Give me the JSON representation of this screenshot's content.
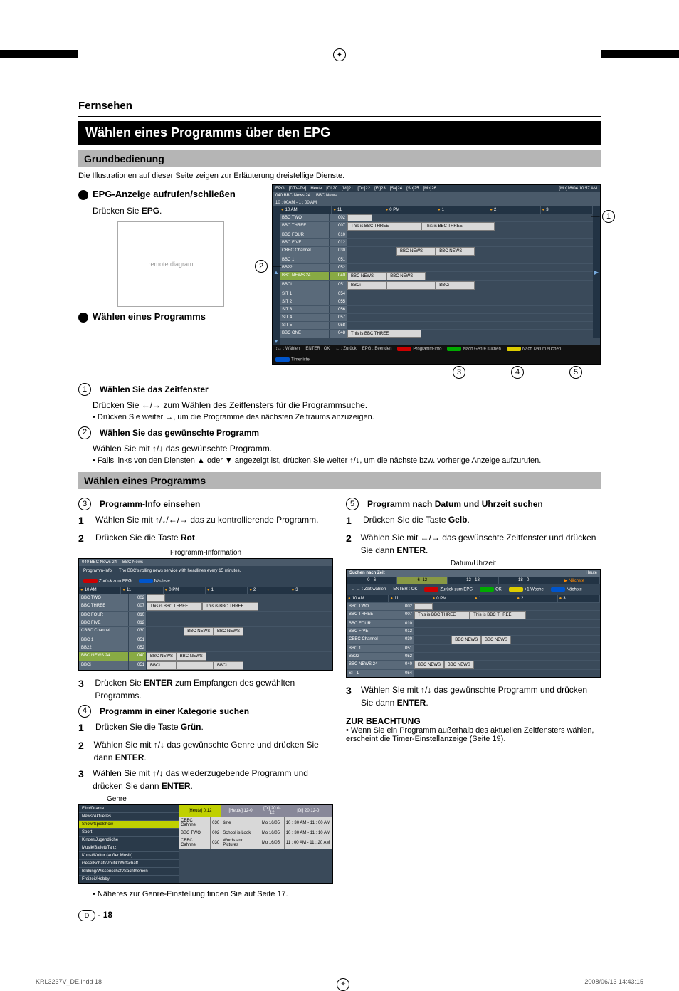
{
  "section": "Fernsehen",
  "title": "Wählen eines Programms über den EPG",
  "sub1": "Grundbedienung",
  "intro": "Die Illustrationen auf dieser Seite zeigen zur Erläuterung dreistellige Dienste.",
  "b1": "EPG-Anzeige aufrufen/schließen",
  "b1_text": "Drücken Sie EPG.",
  "b2": "Wählen eines Programms",
  "step1_head": "Wählen Sie das Zeitfenster",
  "step1_l1": "Drücken Sie ←/→ zum Wählen des Zeitfensters für die Programmsuche.",
  "step1_l2": "• Drücken Sie weiter →, um die Programme des nächsten Zeitraums anzuzeigen.",
  "step2_head": "Wählen Sie das gewünschte Programm",
  "step2_l1": "Wählen Sie mit ↑/↓ das gewünschte Programm.",
  "step2_l2": "• Falls links von den Diensten ▲ oder ▼ angezeigt ist, drücken Sie weiter ↑/↓, um die nächste bzw. vorherige Anzeige aufzurufen.",
  "sub2": "Wählen eines Programms",
  "left_col": {
    "h3": "Programm-Info einsehen",
    "s1": "Wählen Sie mit ↑/↓/←/→ das zu kontrollierende Programm.",
    "s2": "Drücken Sie die Taste Rot.",
    "pi_label": "Programm-Information",
    "s3": "Drücken Sie ENTER zum Empfangen des gewählten Programms.",
    "h4": "Programm in einer Kategorie suchen",
    "s4_1": "Drücken Sie die Taste Grün.",
    "s4_2": "Wählen Sie mit ↑/↓ das gewünschte Genre und drücken Sie dann ENTER.",
    "s4_3": "Wählen Sie mit ↑/↓ das wiederzugebende Programm und drücken Sie dann ENTER.",
    "genre_label": "Genre",
    "genre_note": "• Näheres zur Genre-Einstellung finden Sie auf Seite 17."
  },
  "right_col": {
    "h5": "Programm nach Datum und Uhrzeit suchen",
    "s1": "Drücken Sie die Taste Gelb.",
    "s2": "Wählen Sie mit ←/→ das gewünschte Zeitfenster und drücken Sie dann ENTER.",
    "du_label": "Datum/Uhrzeit",
    "s3": "Wählen Sie mit ↑/↓ das gewünschte Programm und drücken Sie dann ENTER.",
    "note_head": "ZUR BEACHTUNG",
    "note": "• Wenn Sie ein Programm außerhalb des aktuellen Zeitfensters wählen, erscheint die Timer-Einstellanzeige (Seite 19)."
  },
  "epg": {
    "headerLeft": "EPG",
    "mode": "[DTV-TV]",
    "days": [
      "Heute",
      "[Di]20",
      "[Mi]21",
      "[Do]22",
      "[Fr]23",
      "[Sa]24",
      "[So]25",
      "[Mo]26"
    ],
    "now": "[Mo]16/04 10:57 AM",
    "curCh": "040   BBC News 24",
    "curProg": "BBC News",
    "curTime": "10 : 00AM - 1 : 00 AM",
    "times": [
      "10 AM",
      "11",
      "0 PM",
      "1",
      "2",
      "3"
    ],
    "channels": [
      {
        "name": "BBC TWO",
        "num": "002",
        "progs": [
          {
            "t": "",
            "w": "10%"
          }
        ]
      },
      {
        "name": "BBC THREE",
        "num": "007",
        "progs": [
          {
            "t": "This is BBC THREE",
            "w": "30%"
          },
          {
            "t": "This is BBC THREE",
            "w": "30%"
          }
        ]
      },
      {
        "name": "BBC FOUR",
        "num": "010",
        "progs": []
      },
      {
        "name": "BBC FIVE",
        "num": "012",
        "progs": []
      },
      {
        "name": "CBBC Channel",
        "num": "030",
        "progs": [
          {
            "t": "BBC NEWS",
            "w": "16%",
            "off": "20%"
          },
          {
            "t": "BBC NEWS",
            "w": "16%"
          }
        ]
      },
      {
        "name": "BBC 1",
        "num": "051",
        "progs": []
      },
      {
        "name": "BB22",
        "num": "052",
        "progs": []
      },
      {
        "name": "BBC NEWS 24",
        "num": "040",
        "progs": [
          {
            "t": "BBC NEWS",
            "w": "16%"
          },
          {
            "t": "BBC NEWS",
            "w": "16%"
          }
        ],
        "hilite": true
      },
      {
        "name": "BBCi",
        "num": "051",
        "progs": [
          {
            "t": "BBCi",
            "w": "16%"
          },
          {
            "t": "",
            "w": "20%"
          },
          {
            "t": "BBCi",
            "w": "16%"
          }
        ]
      },
      {
        "name": "SIT 1",
        "num": "054",
        "progs": []
      },
      {
        "name": "SIT 2",
        "num": "055",
        "progs": []
      },
      {
        "name": "SIT 3",
        "num": "056",
        "progs": []
      },
      {
        "name": "SIT 4",
        "num": "057",
        "progs": []
      },
      {
        "name": "SIT 5",
        "num": "058",
        "progs": []
      },
      {
        "name": "BBC ONE",
        "num": "048",
        "progs": [
          {
            "t": "This is BBC THREE",
            "w": "30%"
          }
        ]
      }
    ],
    "footer": [
      "↕↔ : Wählen",
      "ENTER : OK",
      "← : Zurück",
      "EPG : Beenden",
      "Programm-Info",
      "Nach Genre suchen",
      "Nach Datum suchen",
      "Timerliste"
    ]
  },
  "pi_screen": {
    "ch": "040   BBC News 24",
    "prog": "BBC News",
    "info_label": "Programm-Info",
    "desc": "The BBC's rolling news service with headlines every 15 minutes.",
    "back": "Zurück zum EPG",
    "next": "Nächste",
    "channels": [
      {
        "name": "BBC TWO",
        "num": "002",
        "progs": [
          {
            "t": "",
            "w": "10%"
          }
        ]
      },
      {
        "name": "BBC THREE",
        "num": "007",
        "progs": [
          {
            "t": "This is BBC THREE",
            "w": "30%"
          },
          {
            "t": "This is BBC THREE",
            "w": "30%"
          }
        ]
      },
      {
        "name": "BBC FOUR",
        "num": "010",
        "progs": []
      },
      {
        "name": "BBC FIVE",
        "num": "012",
        "progs": []
      },
      {
        "name": "CBBC Channel",
        "num": "030",
        "progs": [
          {
            "t": "BBC NEWS",
            "w": "16%",
            "off": "20%"
          },
          {
            "t": "BBC NEWS",
            "w": "16%"
          }
        ]
      },
      {
        "name": "BBC 1",
        "num": "051",
        "progs": []
      },
      {
        "name": "BB22",
        "num": "052",
        "progs": []
      },
      {
        "name": "BBC NEWS 24",
        "num": "040",
        "progs": [
          {
            "t": "BBC NEWS",
            "w": "16%"
          },
          {
            "t": "BBC NEWS",
            "w": "16%"
          }
        ],
        "hilite": true
      },
      {
        "name": "BBCi",
        "num": "051",
        "progs": [
          {
            "t": "BBCi",
            "w": "16%"
          },
          {
            "t": "",
            "w": "20%"
          },
          {
            "t": "BBCi",
            "w": "16%"
          }
        ]
      }
    ]
  },
  "genre_screen": {
    "genres": [
      "Film/Drama",
      "News/Aktuelles",
      "Show/Spielshow",
      "Sport",
      "Kinder/Jugendliche",
      "Musik/Ballett/Tanz",
      "Kunst/Kultur (außer Musik)",
      "Gesellschaft/Politik/Wirtschaft",
      "Bildung/Wissenschaft/Sachthemen",
      "Freizeit/Hobby"
    ],
    "dayTabs": [
      "[Heute] 0:12",
      "[Heute] 12-0",
      "[Di] 20 0-12",
      "[Di] 20 12-0"
    ],
    "rows": [
      {
        "c": "CBBC Cahnnel",
        "n": "030",
        "p": "time",
        "d": "Mo 16/05",
        "t": "10 : 30 AM - 11 : 00 AM"
      },
      {
        "c": "BBC TWO",
        "n": "002",
        "p": "School is Look",
        "d": "Mo 16/05",
        "t": "10 : 30 AM - 11 : 10 AM"
      },
      {
        "c": "CBBC Cahnnel",
        "n": "030",
        "p": "Words and Pictures",
        "d": "Mo 16/05",
        "t": "11 : 00 AM - 11 : 20 AM"
      }
    ]
  },
  "date_screen": {
    "head": "Suchen nach Zeit",
    "heute": "Heute",
    "slots": [
      "0 - 6",
      "6 -12",
      "12 - 18",
      "18 - 0"
    ],
    "next": "Nächste",
    "ctrl": [
      "← → : Zeit wählen",
      "ENTER : OK",
      "Zurück zum EPG",
      "OK",
      "+1 Woche",
      "Nächste"
    ],
    "channels": [
      {
        "name": "BBC TWO",
        "num": "002",
        "progs": [
          {
            "t": "",
            "w": "10%"
          }
        ]
      },
      {
        "name": "BBC THREE",
        "num": "007",
        "progs": [
          {
            "t": "This is BBC THREE",
            "w": "30%"
          },
          {
            "t": "This is BBC THREE",
            "w": "30%"
          }
        ]
      },
      {
        "name": "BBC FOUR",
        "num": "010",
        "progs": []
      },
      {
        "name": "BBC FIVE",
        "num": "012",
        "progs": []
      },
      {
        "name": "CBBC Channel",
        "num": "030",
        "progs": [
          {
            "t": "BBC NEWS",
            "w": "16%",
            "off": "20%"
          },
          {
            "t": "BBC NEWS",
            "w": "16%"
          }
        ]
      },
      {
        "name": "BBC 1",
        "num": "051",
        "progs": []
      },
      {
        "name": "BB22",
        "num": "052",
        "progs": []
      },
      {
        "name": "BBC NEWS 24",
        "num": "040",
        "progs": [
          {
            "t": "BBC NEWS",
            "w": "16%"
          },
          {
            "t": "BBC NEWS",
            "w": "16%"
          }
        ]
      },
      {
        "name": "SIT 1",
        "num": "054",
        "progs": []
      }
    ]
  },
  "pageMark": "D",
  "pageNum": "18",
  "footerL": "KRL3237V_DE.indd   18",
  "footerR": "2008/06/13   14:43:15"
}
